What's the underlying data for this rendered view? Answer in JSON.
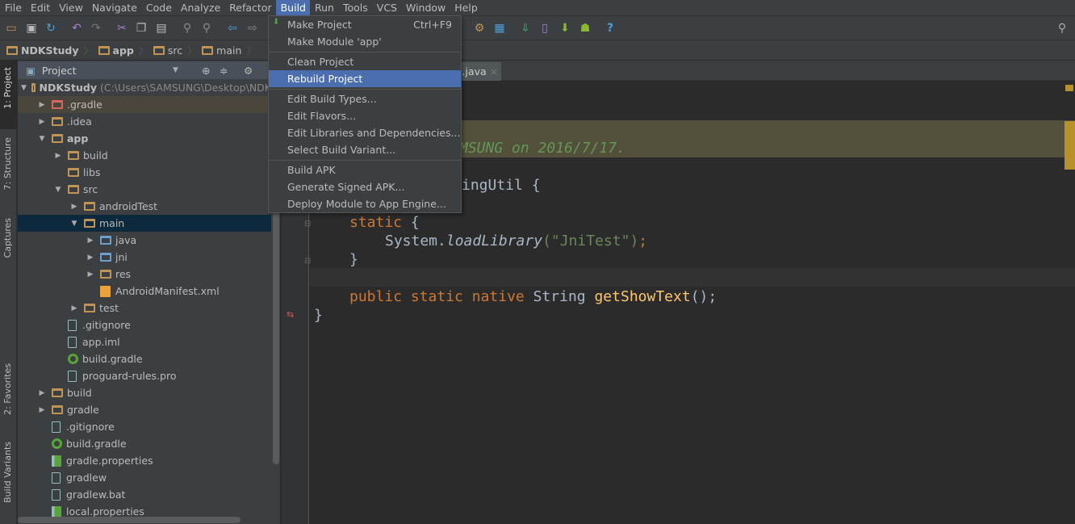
{
  "menubar": [
    "File",
    "Edit",
    "View",
    "Navigate",
    "Code",
    "Analyze",
    "Refactor",
    "Build",
    "Run",
    "Tools",
    "VCS",
    "Window",
    "Help"
  ],
  "breadcrumb": [
    "NDKStudy",
    "app",
    "src",
    "main"
  ],
  "side_tabs": {
    "project": "1: Project",
    "structure": "7: Structure",
    "captures": "Captures",
    "favorites": "2: Favorites",
    "variants": "Build Variants"
  },
  "panel": {
    "title": "Project",
    "root_name": "NDKStudy",
    "root_path": "(C:\\Users\\SAMSUNG\\Desktop\\NDK"
  },
  "tree": [
    ".gradle",
    ".idea",
    "app",
    "build",
    "libs",
    "src",
    "androidTest",
    "main",
    "java",
    "jni",
    "res",
    "AndroidManifest.xml",
    "test",
    ".gitignore",
    "app.iml",
    "build.gradle",
    "proguard-rules.pro",
    "build",
    "gradle",
    ".gitignore",
    "build.gradle",
    "gradle.properties",
    "gradlew",
    "gradlew.bat",
    "local.properties"
  ],
  "editor": {
    "tab": "l.java",
    "comment": "MSUNG on 2016/7/17.",
    "class_frag": "ingUtil {",
    "static_kw": "static",
    "brace_open": "{",
    "system": "System.",
    "load": "loadLibrary",
    "arg": "(\"JniTest\")",
    "semi": ";",
    "brace_close": "}",
    "pub": "public static native",
    "type": "String",
    "method": "getShowText",
    "call_end": "();",
    "end": "}"
  },
  "build_menu": {
    "items": [
      {
        "label": "Make Project",
        "shortcut": "Ctrl+F9"
      },
      {
        "label": "Make Module 'app'"
      },
      {
        "label": "Clean Project"
      },
      {
        "label": "Rebuild Project",
        "highlighted": true
      },
      {
        "label": "Edit Build Types..."
      },
      {
        "label": "Edit Flavors..."
      },
      {
        "label": "Edit Libraries and Dependencies..."
      },
      {
        "label": "Select Build Variant..."
      },
      {
        "label": "Build APK"
      },
      {
        "label": "Generate Signed APK..."
      },
      {
        "label": "Deploy Module to App Engine..."
      }
    ]
  },
  "colors": {
    "highlight": "#4b6eaf",
    "keyword": "#cc7832",
    "string": "#6a8759",
    "comment": "#629755"
  }
}
